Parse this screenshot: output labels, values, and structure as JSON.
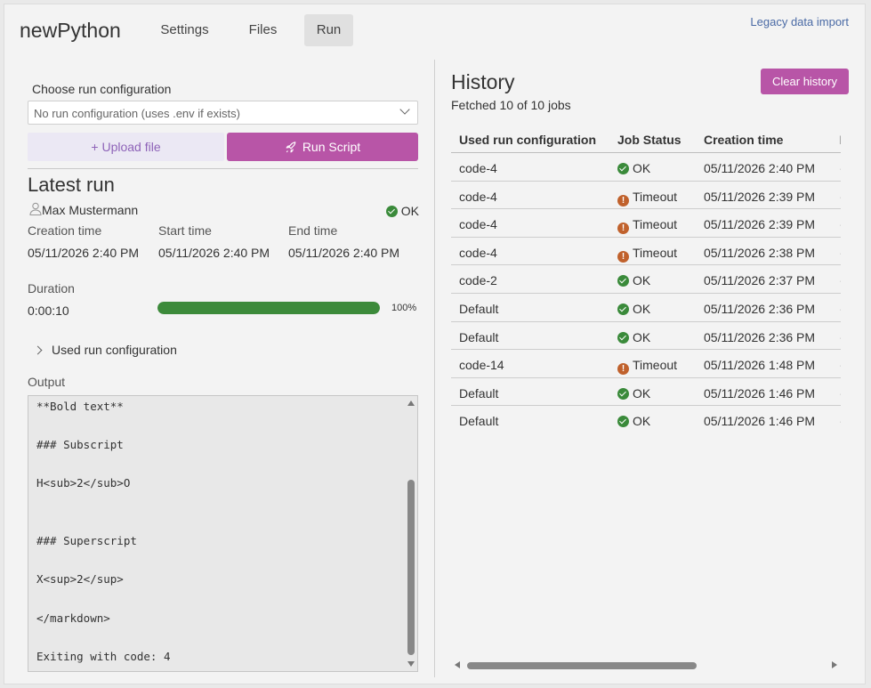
{
  "header": {
    "app_title": "newPython",
    "tabs": [
      {
        "label": "Settings",
        "active": false
      },
      {
        "label": "Files",
        "active": false
      },
      {
        "label": "Run",
        "active": true
      }
    ],
    "legacy_link": "Legacy data import"
  },
  "run_panel": {
    "choose_label": "Choose run configuration",
    "select_value": "No run configuration (uses .env if exists)",
    "upload_label": "+ Upload file",
    "run_label": "Run Script",
    "latest_title": "Latest run",
    "user": "Max Mustermann",
    "status": "OK",
    "creation_label": "Creation time",
    "start_label": "Start time",
    "end_label": "End time",
    "creation_value": "05/11/2026 2:40 PM",
    "start_value": "05/11/2026 2:40 PM",
    "end_value": "05/11/2026 2:40 PM",
    "duration_label": "Duration",
    "duration_value": "0:00:10",
    "progress_percent": 100,
    "progress_label": "100%",
    "used_config_label": "Used run configuration",
    "output_label": "Output",
    "output_text": "**Bold text**\n\n### Subscript\n\nH<sub>2</sub>O\n\n\n### Superscript\n\nX<sup>2</sup>\n\n</markdown>\n\nExiting with code: 4"
  },
  "history": {
    "title": "History",
    "fetched": "Fetched 10 of 10 jobs",
    "clear_label": "Clear history",
    "columns": [
      "Used run configuration",
      "Job Status",
      "Creation time",
      "I"
    ],
    "rows": [
      {
        "config": "code-4",
        "status": "OK",
        "ok": true,
        "time": "05/11/2026 2:40 PM"
      },
      {
        "config": "code-4",
        "status": "Timeout",
        "ok": false,
        "time": "05/11/2026 2:39 PM"
      },
      {
        "config": "code-4",
        "status": "Timeout",
        "ok": false,
        "time": "05/11/2026 2:39 PM"
      },
      {
        "config": "code-4",
        "status": "Timeout",
        "ok": false,
        "time": "05/11/2026 2:38 PM"
      },
      {
        "config": "code-2",
        "status": "OK",
        "ok": true,
        "time": "05/11/2026 2:37 PM"
      },
      {
        "config": "Default",
        "status": "OK",
        "ok": true,
        "time": "05/11/2026 2:36 PM"
      },
      {
        "config": "Default",
        "status": "OK",
        "ok": true,
        "time": "05/11/2026 2:36 PM"
      },
      {
        "config": "code-14",
        "status": "Timeout",
        "ok": false,
        "time": "05/11/2026 1:48 PM"
      },
      {
        "config": "Default",
        "status": "OK",
        "ok": true,
        "time": "05/11/2026 1:46 PM"
      },
      {
        "config": "Default",
        "status": "OK",
        "ok": true,
        "time": "05/11/2026 1:46 PM"
      }
    ]
  },
  "colors": {
    "accent": "#b855a7",
    "ok": "#3a8a3a",
    "timeout": "#c0612c"
  },
  "icons": {
    "upload": "plus-icon",
    "run": "rocket-icon",
    "user": "user-icon",
    "ok": "check-circle-icon",
    "timeout": "exclamation-circle-icon"
  }
}
